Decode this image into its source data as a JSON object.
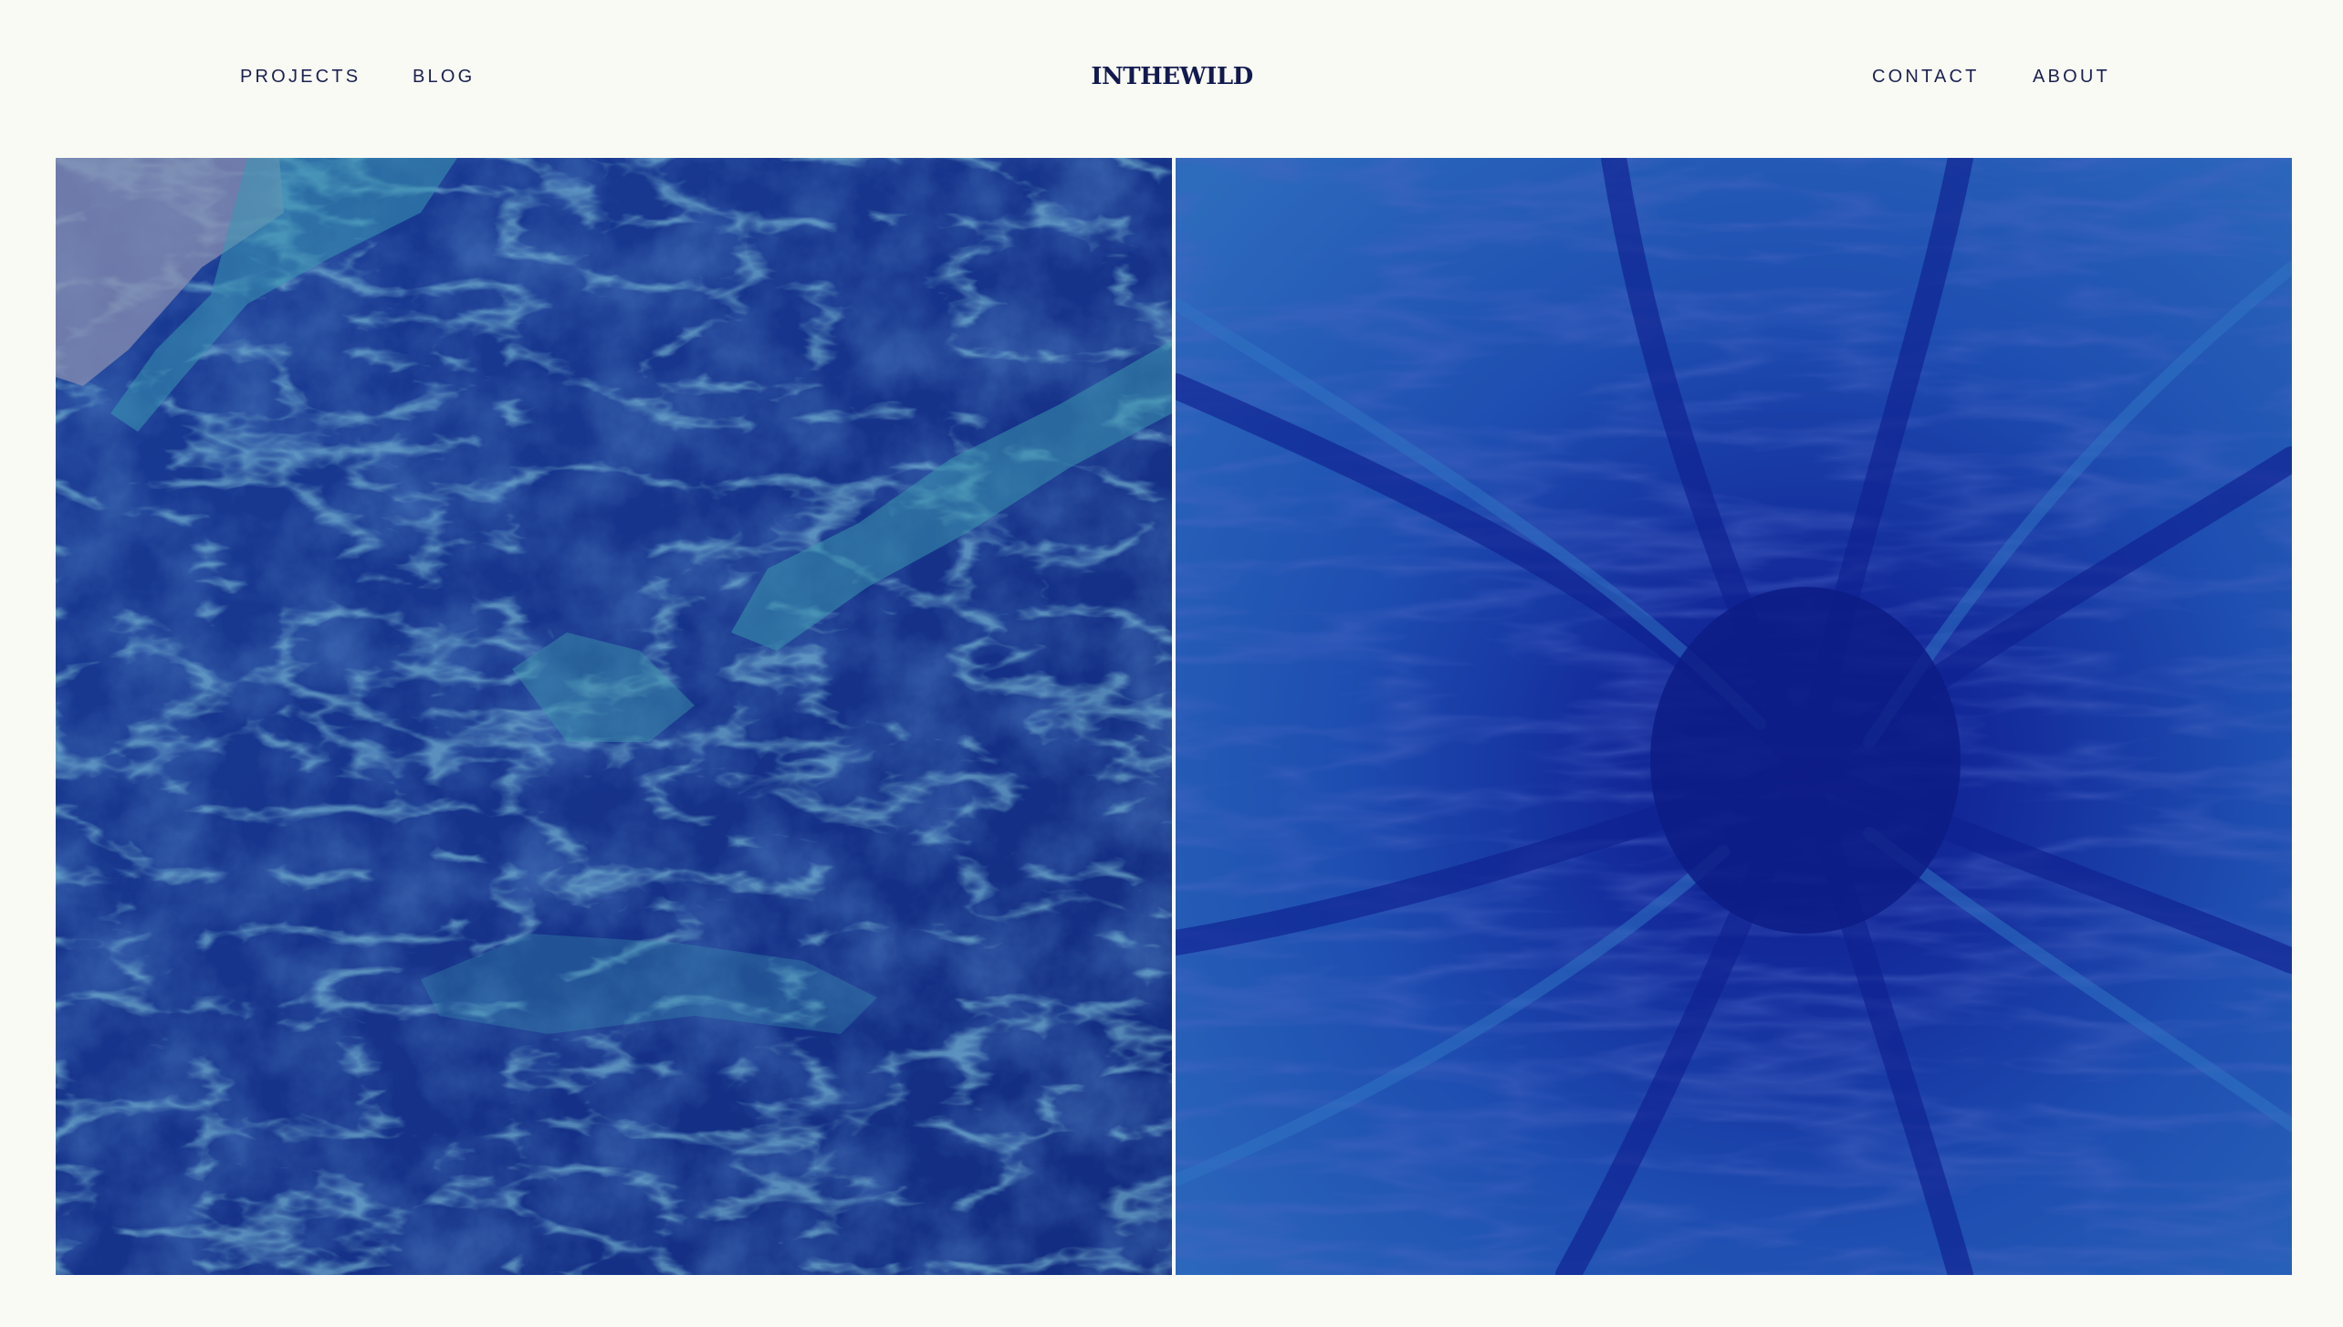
{
  "nav": {
    "left": [
      {
        "label": "PROJECTS"
      },
      {
        "label": "BLOG"
      }
    ],
    "right": [
      {
        "label": "CONTACT"
      },
      {
        "label": "ABOUT"
      }
    ]
  },
  "brand": {
    "logo_text": "INTHEWILD"
  },
  "gallery": {
    "images": [
      {
        "subject": "blue marbled stone texture"
      },
      {
        "subject": "blue ink swirl burst texture"
      }
    ]
  },
  "colors": {
    "background": "#f9faf4",
    "text": "#1b2150",
    "image_primary": "#14308c",
    "image_accent": "#3a8fb0"
  }
}
